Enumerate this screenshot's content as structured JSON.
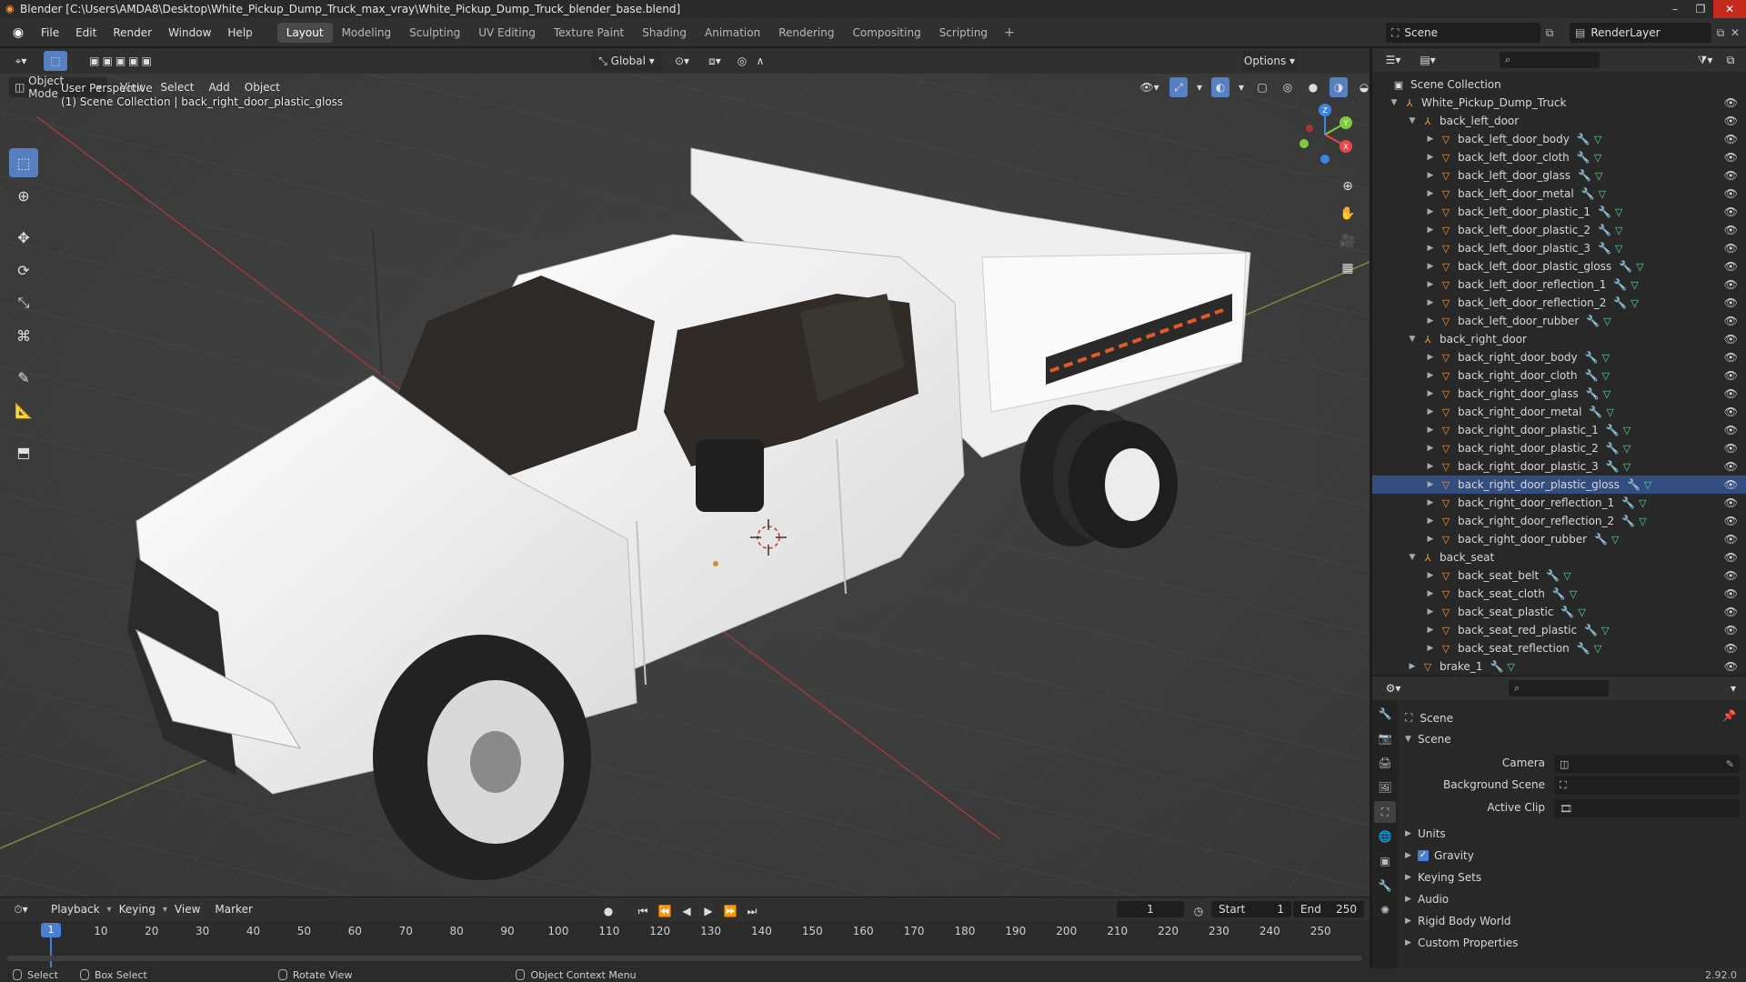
{
  "window": {
    "title": "Blender [C:\\Users\\AMDA8\\Desktop\\White_Pickup_Dump_Truck_max_vray\\White_Pickup_Dump_Truck_blender_base.blend]"
  },
  "menu": [
    "File",
    "Edit",
    "Render",
    "Window",
    "Help"
  ],
  "workspaces": [
    "Layout",
    "Modeling",
    "Sculpting",
    "UV Editing",
    "Texture Paint",
    "Shading",
    "Animation",
    "Rendering",
    "Compositing",
    "Scripting"
  ],
  "active_workspace": "Layout",
  "scene_selector": "Scene",
  "view_layer_selector": "RenderLayer",
  "viewport": {
    "mode": "Object Mode",
    "menus": [
      "View",
      "Select",
      "Add",
      "Object"
    ],
    "transform_orientation": "Global",
    "options_label": "Options",
    "overlay_line1": "User Perspective",
    "overlay_line2": "(1) Scene Collection | back_right_door_plastic_gloss",
    "gizmo_axes": {
      "x": "X",
      "y": "Y",
      "z": "Z"
    }
  },
  "timeline": {
    "menus": [
      "Playback",
      "Keying",
      "View",
      "Marker"
    ],
    "current_frame": "1",
    "start_label": "Start",
    "start_value": "1",
    "end_label": "End",
    "end_value": "250",
    "ticks": [
      "10",
      "20",
      "30",
      "40",
      "50",
      "60",
      "70",
      "80",
      "90",
      "100",
      "110",
      "120",
      "130",
      "140",
      "150",
      "160",
      "170",
      "180",
      "190",
      "200",
      "210",
      "220",
      "230",
      "240",
      "250"
    ],
    "playhead_label": "1"
  },
  "status": {
    "select": "Select",
    "box_select": "Box Select",
    "rotate_view": "Rotate View",
    "context_menu": "Object Context Menu",
    "version": "2.92.0"
  },
  "outliner": {
    "root": "Scene Collection",
    "rows": [
      {
        "label": "White_Pickup_Dump_Truck",
        "level": 1,
        "type": "empty",
        "expanded": true
      },
      {
        "label": "back_left_door",
        "level": 2,
        "type": "empty",
        "expanded": true
      },
      {
        "label": "back_left_door_body",
        "level": 3,
        "type": "mesh"
      },
      {
        "label": "back_left_door_cloth",
        "level": 3,
        "type": "mesh"
      },
      {
        "label": "back_left_door_glass",
        "level": 3,
        "type": "mesh"
      },
      {
        "label": "back_left_door_metal",
        "level": 3,
        "type": "mesh"
      },
      {
        "label": "back_left_door_plastic_1",
        "level": 3,
        "type": "mesh"
      },
      {
        "label": "back_left_door_plastic_2",
        "level": 3,
        "type": "mesh"
      },
      {
        "label": "back_left_door_plastic_3",
        "level": 3,
        "type": "mesh"
      },
      {
        "label": "back_left_door_plastic_gloss",
        "level": 3,
        "type": "mesh"
      },
      {
        "label": "back_left_door_reflection_1",
        "level": 3,
        "type": "mesh"
      },
      {
        "label": "back_left_door_reflection_2",
        "level": 3,
        "type": "mesh"
      },
      {
        "label": "back_left_door_rubber",
        "level": 3,
        "type": "mesh"
      },
      {
        "label": "back_right_door",
        "level": 2,
        "type": "empty",
        "expanded": true
      },
      {
        "label": "back_right_door_body",
        "level": 3,
        "type": "mesh"
      },
      {
        "label": "back_right_door_cloth",
        "level": 3,
        "type": "mesh"
      },
      {
        "label": "back_right_door_glass",
        "level": 3,
        "type": "mesh"
      },
      {
        "label": "back_right_door_metal",
        "level": 3,
        "type": "mesh"
      },
      {
        "label": "back_right_door_plastic_1",
        "level": 3,
        "type": "mesh"
      },
      {
        "label": "back_right_door_plastic_2",
        "level": 3,
        "type": "mesh"
      },
      {
        "label": "back_right_door_plastic_3",
        "level": 3,
        "type": "mesh"
      },
      {
        "label": "back_right_door_plastic_gloss",
        "level": 3,
        "type": "mesh",
        "active": true
      },
      {
        "label": "back_right_door_reflection_1",
        "level": 3,
        "type": "mesh"
      },
      {
        "label": "back_right_door_reflection_2",
        "level": 3,
        "type": "mesh"
      },
      {
        "label": "back_right_door_rubber",
        "level": 3,
        "type": "mesh"
      },
      {
        "label": "back_seat",
        "level": 2,
        "type": "empty",
        "expanded": true
      },
      {
        "label": "back_seat_belt",
        "level": 3,
        "type": "mesh"
      },
      {
        "label": "back_seat_cloth",
        "level": 3,
        "type": "mesh"
      },
      {
        "label": "back_seat_plastic",
        "level": 3,
        "type": "mesh"
      },
      {
        "label": "back_seat_red_plastic",
        "level": 3,
        "type": "mesh"
      },
      {
        "label": "back_seat_reflection",
        "level": 3,
        "type": "mesh"
      },
      {
        "label": "brake_1",
        "level": 2,
        "type": "mesh"
      }
    ]
  },
  "properties": {
    "context_title": "Scene",
    "panel_title": "Scene",
    "camera_label": "Camera",
    "background_scene_label": "Background Scene",
    "active_clip_label": "Active Clip",
    "subpanels": [
      "Units",
      "Gravity",
      "Keying Sets",
      "Audio",
      "Rigid Body World",
      "Custom Properties"
    ],
    "gravity_checked": true
  },
  "colors": {
    "accent": "#5680c2",
    "selection": "#334d80",
    "object_orange": "#f0973d",
    "mesh_green": "#5fd6a0",
    "gizmo_x": "#e5484d",
    "gizmo_y": "#7fcc3a",
    "gizmo_z": "#3d86e0"
  }
}
